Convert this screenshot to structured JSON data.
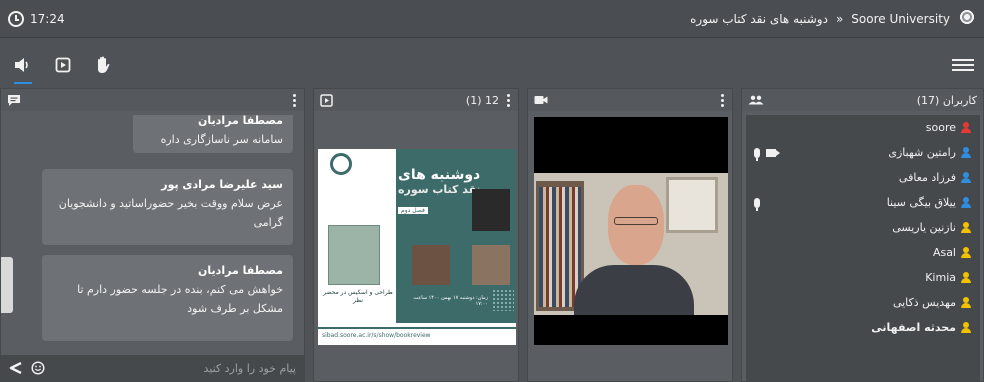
{
  "topbar": {
    "time": "17:24",
    "university": "Soore University",
    "separator": "»",
    "session_title": "دوشنبه های نقد کتاب سوره"
  },
  "toolbar": {
    "icons": [
      "speaker-icon",
      "presentation-icon",
      "raise-hand-icon"
    ]
  },
  "chat": {
    "messages": [
      {
        "sender": "مصطفا مرادیان",
        "text": "سامانه سر ناسازگاری داره"
      },
      {
        "sender": "سید علیرضا مرادی پور",
        "text": "عرض سلام  ووقت بخیر حضوراساتید و دانشجویان گرامی"
      },
      {
        "sender": "مصطفا مرادیان",
        "text": "خواهش می کنم، بنده در جلسه حضور دارم تا مشکل بر طرف شود"
      }
    ],
    "input_placeholder": "پیام خود را وارد کنید"
  },
  "presentation": {
    "counter": "(1) 12",
    "poster": {
      "title_line1": "دوشنبه های",
      "title_line2": "نقد کتاب سوره",
      "session": "فصل دوم",
      "book_title": "طراحی و اسکیس در محضر نظر",
      "date_line": "زمان: دوشنبه ۱۷ بهمن ۱۴۰۰ ساعت ۱۷:۰۰",
      "link": "sibad.soore.ac.ir/s/show/bookreview"
    }
  },
  "users": {
    "title": "کاربران (17)",
    "list": [
      {
        "name": "soore",
        "color": "#e53935",
        "mic": false,
        "cam": false,
        "bold": false
      },
      {
        "name": "رامتین شهبازی",
        "color": "#2f8ee0",
        "mic": true,
        "cam": true,
        "bold": false
      },
      {
        "name": "فرزاد معافی",
        "color": "#2f8ee0",
        "mic": false,
        "cam": false,
        "bold": false
      },
      {
        "name": "ییلاق بیگی سینا",
        "color": "#2f8ee0",
        "mic": true,
        "cam": false,
        "bold": false
      },
      {
        "name": "نازنین یاریسی",
        "color": "#f2c200",
        "mic": false,
        "cam": false,
        "bold": false
      },
      {
        "name": "Asal",
        "color": "#f2c200",
        "mic": false,
        "cam": false,
        "bold": false
      },
      {
        "name": "Kimia",
        "color": "#f2c200",
        "mic": false,
        "cam": false,
        "bold": false
      },
      {
        "name": "مهدیس ذکایی",
        "color": "#f2c200",
        "mic": false,
        "cam": false,
        "bold": false
      },
      {
        "name": "محدثه اصفهانی",
        "color": "#f2c200",
        "mic": false,
        "cam": false,
        "bold": true
      }
    ]
  },
  "colors": {
    "accent": "#2f8ee0",
    "background": "#4f5357",
    "panel": "#5a5e62",
    "bubble": "#6e7276",
    "poster_green": "#3d6b6a"
  }
}
